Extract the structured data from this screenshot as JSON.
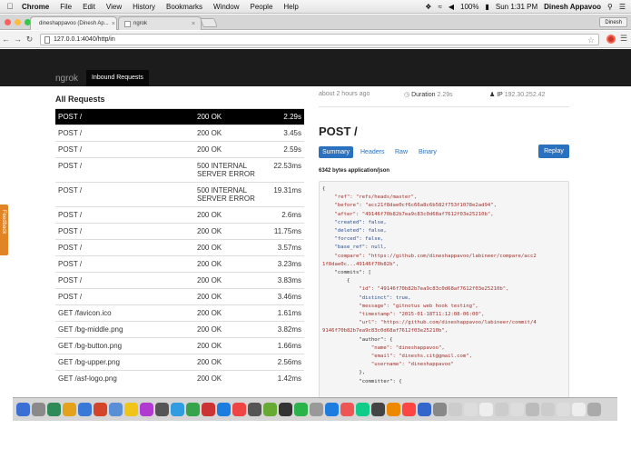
{
  "menubar": {
    "apple": "",
    "app": "Chrome",
    "items": [
      "File",
      "Edit",
      "View",
      "History",
      "Bookmarks",
      "Window",
      "People",
      "Help"
    ],
    "battery": "100%",
    "clock": "Sun 1:31 PM",
    "user": "Dinesh Appavoo"
  },
  "browser": {
    "tabs": [
      {
        "title": "dineshappavoo (Dinesh Ap...",
        "active": true
      },
      {
        "title": "ngrok",
        "active": false
      }
    ],
    "profile": "Dinesh",
    "url": "127.0.0.1:4040/http/in"
  },
  "ngrok": {
    "brand": "ngrok",
    "nav": "Inbound Requests"
  },
  "requests": {
    "title": "All Requests",
    "rows": [
      {
        "method": "POST /",
        "status": "200 OK",
        "duration": "2.29s",
        "selected": true
      },
      {
        "method": "POST /",
        "status": "200 OK",
        "duration": "3.45s"
      },
      {
        "method": "POST /",
        "status": "200 OK",
        "duration": "2.59s"
      },
      {
        "method": "POST /",
        "status": "500 INTERNAL SERVER ERROR",
        "duration": "22.53ms"
      },
      {
        "method": "POST /",
        "status": "500 INTERNAL SERVER ERROR",
        "duration": "19.31ms"
      },
      {
        "method": "POST /",
        "status": "200 OK",
        "duration": "2.6ms"
      },
      {
        "method": "POST /",
        "status": "200 OK",
        "duration": "11.75ms"
      },
      {
        "method": "POST /",
        "status": "200 OK",
        "duration": "3.57ms"
      },
      {
        "method": "POST /",
        "status": "200 OK",
        "duration": "3.23ms"
      },
      {
        "method": "POST /",
        "status": "200 OK",
        "duration": "3.83ms"
      },
      {
        "method": "POST /",
        "status": "200 OK",
        "duration": "3.46ms"
      },
      {
        "method": "GET /favicon.ico",
        "status": "200 OK",
        "duration": "1.61ms"
      },
      {
        "method": "GET /bg-middle.png",
        "status": "200 OK",
        "duration": "3.82ms"
      },
      {
        "method": "GET /bg-button.png",
        "status": "200 OK",
        "duration": "1.66ms"
      },
      {
        "method": "GET /bg-upper.png",
        "status": "200 OK",
        "duration": "2.56ms"
      },
      {
        "method": "GET /asf-logo.png",
        "status": "200 OK",
        "duration": "1.42ms"
      }
    ]
  },
  "detail": {
    "time": "about 2 hours ago",
    "duration_label": "Duration",
    "duration": "2.29s",
    "ip_label": "IP",
    "ip": "192.30.252.42",
    "title": "POST /",
    "tabs": [
      "Summary",
      "Headers",
      "Raw",
      "Binary"
    ],
    "replay": "Replay",
    "content_type": "6342 bytes application/json",
    "json_lines": [
      "{",
      "    \"ref\": \"refs/heads/master\",",
      "    \"before\": \"acc21f8dae0cf6c66a8c6b582f753f1078e2ad94\",",
      "    \"after\": \"49146f70b82b7ea9c83c0d68af7612f03e25210b\",",
      "    \"created\": false,",
      "    \"deleted\": false,",
      "    \"forced\": false,",
      "    \"base_ref\": null,",
      "    \"compare\": \"https://github.com/dineshappavoo/labineer/compare/acc2",
      "1f8dae0c...49146f70b82b\",",
      "    \"commits\": [",
      "        {",
      "            \"id\": \"49146f70b82b7ea9c83c0d68af7612f03e25210b\",",
      "            \"distinct\": true,",
      "            \"message\": \"gitnotus web hook testing\",",
      "            \"timestamp\": \"2015-01-18T11:12:08-06:00\",",
      "            \"url\": \"https://github.com/dineshappavoo/labineer/commit/4",
      "9146f70b82b7ea9c83c0d68af7612f03e25210b\",",
      "            \"author\": {",
      "                \"name\": \"dineshappavoo\",",
      "                \"email\": \"dineshs.cit@gmail.com\",",
      "                \"username\": \"dineshappavoo\"",
      "            },",
      "            \"committer\": {"
    ]
  },
  "feedback": "Feedback",
  "colors": {
    "accent": "#2a72c0",
    "header_bg": "#1c1c1c",
    "selected_row": "#000000",
    "feedback": "#e08426"
  }
}
